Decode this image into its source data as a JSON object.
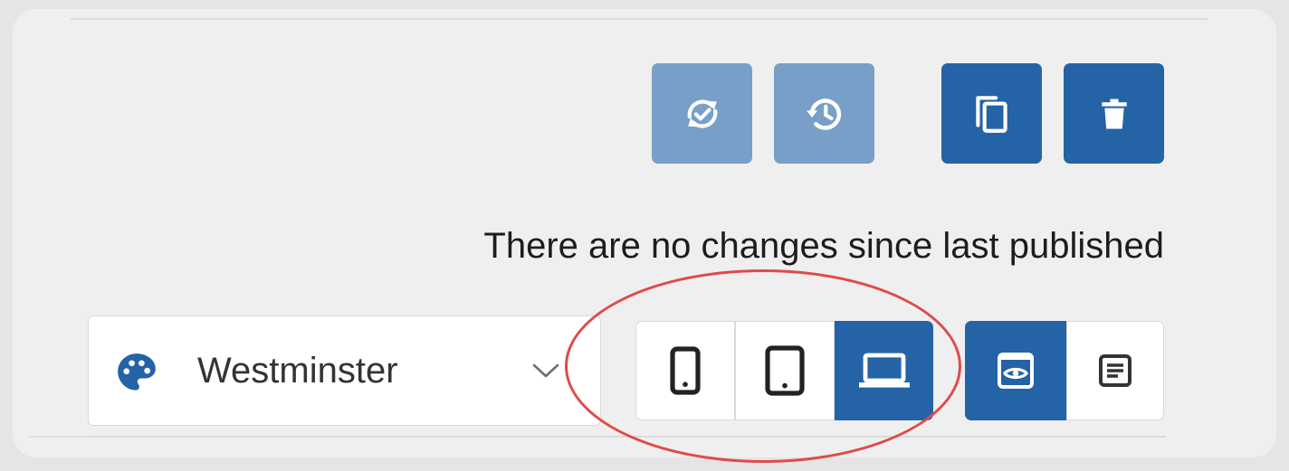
{
  "toolbar": {
    "buttons": [
      {
        "name": "sync-changes-button",
        "icon": "sync-check-icon",
        "style": "disabled"
      },
      {
        "name": "history-button",
        "icon": "history-icon",
        "style": "disabled"
      },
      {
        "name": "duplicate-button",
        "icon": "copy-icon",
        "style": "primary"
      },
      {
        "name": "delete-button",
        "icon": "trash-icon",
        "style": "primary"
      }
    ],
    "colors": {
      "primary": "#2463a6",
      "disabled": "#789fc7"
    }
  },
  "status": {
    "message": "There are no changes since last published"
  },
  "theme": {
    "icon": "palette-icon",
    "selected": "Westminster",
    "dropdown_icon": "chevron-down-icon"
  },
  "device_preview": {
    "options": [
      {
        "name": "mobile",
        "icon": "phone-icon",
        "active": false
      },
      {
        "name": "tablet",
        "icon": "tablet-icon",
        "active": false
      },
      {
        "name": "desktop",
        "icon": "laptop-icon",
        "active": true
      }
    ]
  },
  "view_mode": {
    "options": [
      {
        "name": "preview",
        "icon": "preview-eye-icon",
        "active": true
      },
      {
        "name": "form",
        "icon": "form-icon",
        "active": false
      }
    ]
  },
  "annotation": {
    "shape": "ellipse",
    "color": "#e04a4a"
  }
}
